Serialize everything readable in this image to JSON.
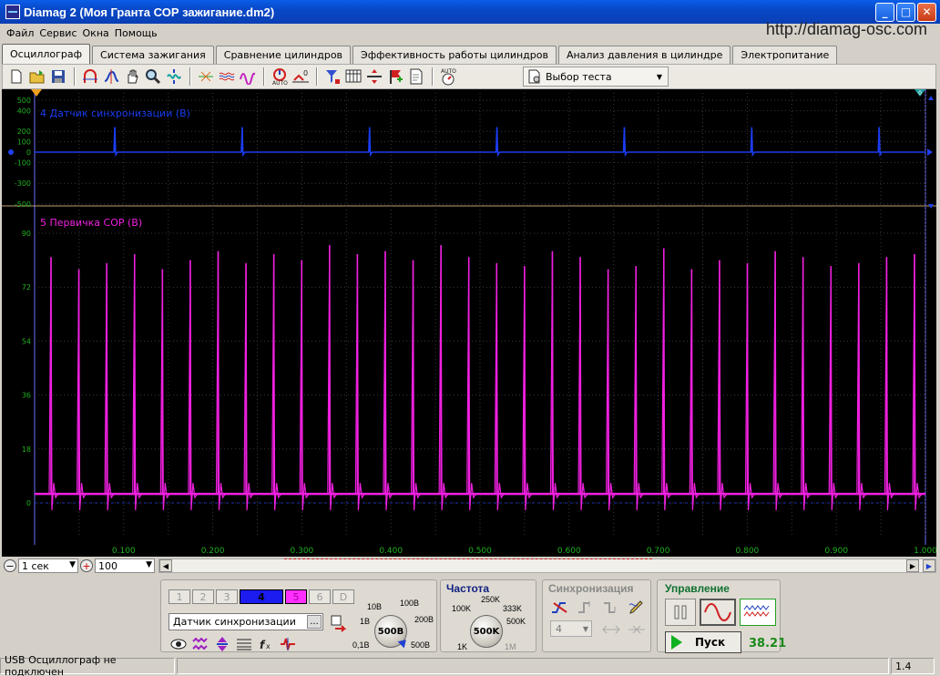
{
  "window": {
    "title": "Diamag 2 (Моя Гранта СОР зажигание.dm2)",
    "url_label": "http://diamag-osc.com"
  },
  "menu": [
    "Файл",
    "Сервис",
    "Окна",
    "Помощь"
  ],
  "tabs": [
    {
      "label": "Осциллограф",
      "active": true
    },
    {
      "label": "Система зажигания"
    },
    {
      "label": "Сравнение цилиндров"
    },
    {
      "label": "Эффективность работы цилиндров"
    },
    {
      "label": "Анализ давления в цилиндре"
    },
    {
      "label": "Электропитание"
    }
  ],
  "toolbar": {
    "icons": [
      "new-file-icon",
      "open-folder-icon",
      "save-icon",
      "cursor-a-icon",
      "cursor-b-icon",
      "hand-icon",
      "zoom-icon",
      "autoscale-icon",
      "wave-marker-icon",
      "wave-overlay-icon",
      "wave-compare-icon",
      "auto-trigger-icon",
      "zero-offset-icon",
      "filter-icon",
      "table-icon",
      "split-icon",
      "flag-icon",
      "notes-icon",
      "auto-range-icon"
    ],
    "test_select_label": "Выбор теста"
  },
  "scope": {
    "ch4": {
      "label": "4 Датчик синхронизации (В)",
      "color": "#1b3cf0",
      "ticks": [
        "500",
        "400",
        "200",
        "100",
        "0",
        "-100",
        "-300",
        "-500"
      ]
    },
    "ch5": {
      "label": "5 Первичка СОР (В)",
      "color": "#f020e0",
      "ticks": [
        "90",
        "72",
        "54",
        "36",
        "18",
        "0"
      ]
    },
    "x_ticks": [
      "0.100",
      "0.200",
      "0.300",
      "0.400",
      "0.500",
      "0.600",
      "0.700",
      "0.800",
      "0.900",
      "1.000"
    ],
    "top_right_marker": "0"
  },
  "chart_data": {
    "type": "line",
    "x": [
      0.09,
      0.233,
      0.376,
      0.519,
      0.662,
      0.805,
      0.948
    ],
    "series": [
      {
        "name": "4 Датчик синхронизации (В)",
        "values": [
          240,
          240,
          240,
          240,
          240,
          240,
          240
        ]
      }
    ],
    "spikes_ch5_peak_v": [
      82,
      78,
      80,
      83,
      78,
      81,
      84,
      80,
      83,
      81,
      86,
      83,
      84,
      81,
      86,
      82,
      80,
      79,
      84,
      82,
      78,
      79,
      85,
      78,
      81,
      80,
      84,
      82,
      79,
      80,
      82,
      83
    ],
    "ch5_baseline_v": 3,
    "xlim": [
      0,
      1.0
    ],
    "ch4_ylim": [
      -500,
      500
    ],
    "ch5_ylim": [
      0,
      90
    ],
    "grid": true
  },
  "scroll": {
    "time_value": "1 сек",
    "scale_value": "100"
  },
  "channels": {
    "buttons": [
      "1",
      "2",
      "3",
      "4",
      "5",
      "6",
      "D"
    ],
    "sensor_value": "Датчик синхронизации",
    "sensor_dots": "...",
    "volt_labels": [
      "10В",
      "100В",
      "1В",
      "200В",
      "0,1В",
      "500В"
    ],
    "volt_value": "500В"
  },
  "frequency": {
    "title": "Частота",
    "labels": [
      "250K",
      "100K",
      "333K",
      "500K",
      "1K",
      "1M"
    ],
    "value": "500K"
  },
  "sync": {
    "title": "Синхронизация",
    "channel_value": "4"
  },
  "control": {
    "title": "Управление",
    "run_label": "Пуск",
    "counter": "38.21"
  },
  "status": {
    "message": "USB Осциллограф не подключен",
    "version": "1.4"
  }
}
